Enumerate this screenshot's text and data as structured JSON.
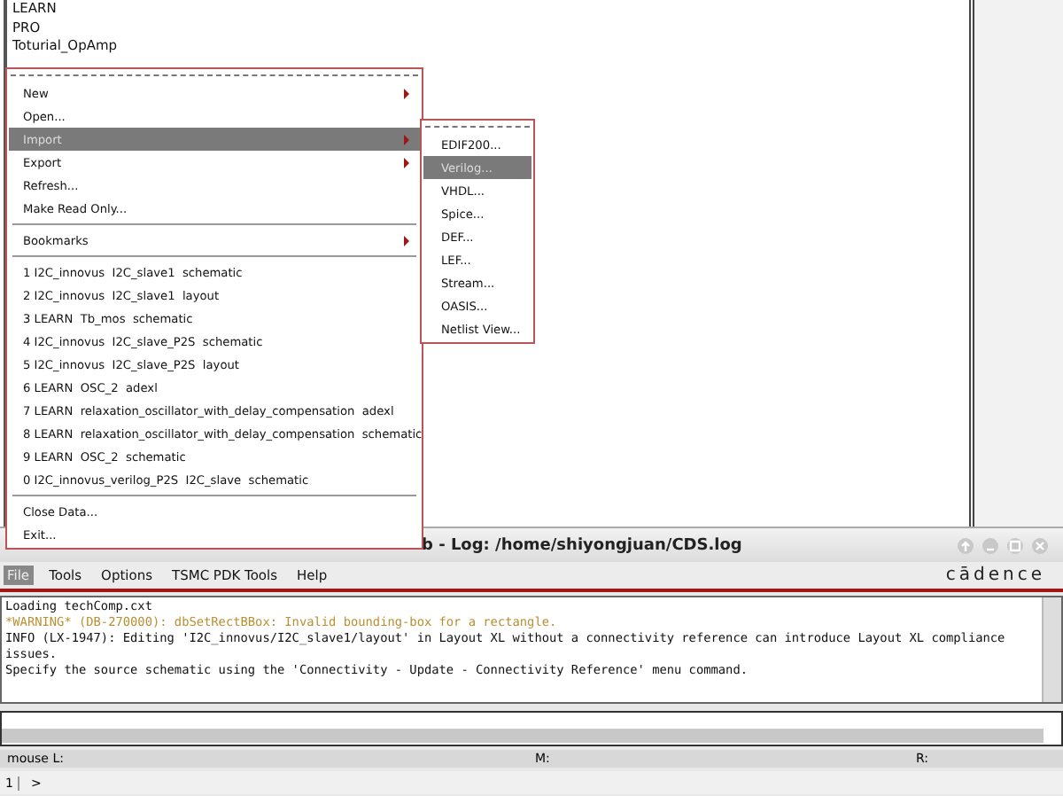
{
  "library_list": {
    "items": [
      "LEARN",
      "PRO",
      "Toturial_OpAmp"
    ]
  },
  "file_menu": {
    "sections": [
      [
        {
          "label": "New",
          "submenu": true,
          "selected": false
        },
        {
          "label": "Open...",
          "submenu": false,
          "selected": false
        },
        {
          "label": "Import",
          "submenu": true,
          "selected": true
        },
        {
          "label": "Export",
          "submenu": true,
          "selected": false
        },
        {
          "label": "Refresh...",
          "submenu": false,
          "selected": false
        },
        {
          "label": "Make Read Only...",
          "submenu": false,
          "selected": false
        }
      ],
      [
        {
          "label": "Bookmarks",
          "submenu": true,
          "selected": false
        }
      ],
      [
        {
          "label": "1 I2C_innovus  I2C_slave1  schematic",
          "submenu": false,
          "selected": false
        },
        {
          "label": "2 I2C_innovus  I2C_slave1  layout",
          "submenu": false,
          "selected": false
        },
        {
          "label": "3 LEARN  Tb_mos  schematic",
          "submenu": false,
          "selected": false
        },
        {
          "label": "4 I2C_innovus  I2C_slave_P2S  schematic",
          "submenu": false,
          "selected": false
        },
        {
          "label": "5 I2C_innovus  I2C_slave_P2S  layout",
          "submenu": false,
          "selected": false
        },
        {
          "label": "6 LEARN  OSC_2  adexl",
          "submenu": false,
          "selected": false
        },
        {
          "label": "7 LEARN  relaxation_oscillator_with_delay_compensation  adexl",
          "submenu": false,
          "selected": false
        },
        {
          "label": "8 LEARN  relaxation_oscillator_with_delay_compensation  schematic",
          "submenu": false,
          "selected": false
        },
        {
          "label": "9 LEARN  OSC_2  schematic",
          "submenu": false,
          "selected": false
        },
        {
          "label": "0 I2C_innovus_verilog_P2S  I2C_slave  schematic",
          "submenu": false,
          "selected": false
        }
      ],
      [
        {
          "label": "Close Data...",
          "submenu": false,
          "selected": false
        },
        {
          "label": "Exit...",
          "submenu": false,
          "selected": false
        }
      ]
    ]
  },
  "import_submenu": {
    "items": [
      {
        "label": "EDIF200...",
        "selected": false
      },
      {
        "label": "Verilog...",
        "selected": true
      },
      {
        "label": "VHDL...",
        "selected": false
      },
      {
        "label": "Spice...",
        "selected": false
      },
      {
        "label": "DEF...",
        "selected": false
      },
      {
        "label": "LEF...",
        "selected": false
      },
      {
        "label": "Stream...",
        "selected": false
      },
      {
        "label": "OASIS...",
        "selected": false
      },
      {
        "label": "Netlist View...",
        "selected": false
      }
    ]
  },
  "log_window": {
    "title": "b - Log: /home/shiyongjuan/CDS.log",
    "menu_bar": [
      {
        "label": "File",
        "selected": true
      },
      {
        "label": "Tools",
        "selected": false
      },
      {
        "label": "Options",
        "selected": false
      },
      {
        "label": "TSMC PDK Tools",
        "selected": false
      },
      {
        "label": "Help",
        "selected": false
      }
    ],
    "logo": "cādence",
    "lines": [
      {
        "kind": "info",
        "text": "Loading techComp.cxt"
      },
      {
        "kind": "warning",
        "text": "*WARNING* (DB-270000): dbSetRectBBox: Invalid bounding-box for a rectangle."
      },
      {
        "kind": "info",
        "text": "INFO (LX-1947): Editing 'I2C_innovus/I2C_slave1/layout' in Layout XL without a connectivity reference can introduce Layout XL compliance"
      },
      {
        "kind": "info",
        "text": "issues."
      },
      {
        "kind": "info",
        "text": "Specify the source schematic using the 'Connectivity - Update - Connectivity Reference' menu command."
      }
    ],
    "status_bar": [
      "mouse L:",
      "M:",
      "R:"
    ],
    "command_line": {
      "number": "1",
      "prompt": ">"
    }
  }
}
